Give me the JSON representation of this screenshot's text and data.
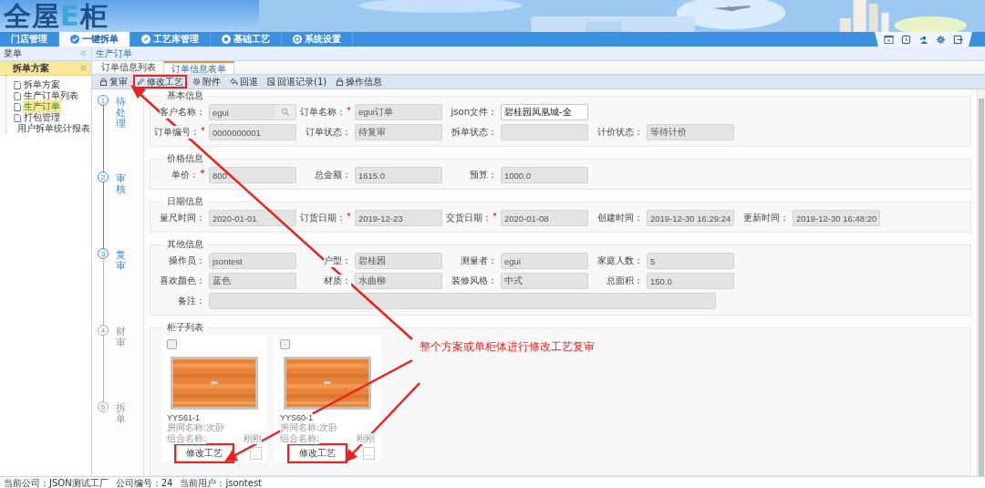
{
  "logo": [
    {
      "text": "全屋",
      "accent": false
    },
    {
      "text": "E",
      "accent": true
    },
    {
      "text": "柜",
      "accent": false
    }
  ],
  "nav_tabs": [
    {
      "label": "门店管理",
      "selected": false
    },
    {
      "label": "一键拆单",
      "selected": true
    },
    {
      "label": "工艺库管理",
      "selected": false
    },
    {
      "label": "基础工艺",
      "selected": false
    },
    {
      "label": "系统设置",
      "selected": false
    }
  ],
  "sidebar": {
    "title": "菜单",
    "group": {
      "label": "拆单方案",
      "expanded": true
    },
    "items": [
      {
        "label": "拆单方案",
        "selected": false
      },
      {
        "label": "生产订单列表",
        "selected": false
      },
      {
        "label": "生产订单",
        "selected": true
      },
      {
        "label": "打包管理",
        "selected": false
      },
      {
        "label": "用户拆单统计报表",
        "selected": false
      }
    ]
  },
  "breadcrumb": "生产订单",
  "page_tabs": [
    {
      "label": "订单信息列表",
      "selected": false
    },
    {
      "label": "订单信息表单",
      "selected": true
    }
  ],
  "toolbar": [
    {
      "label": "复审",
      "highlighted": false
    },
    {
      "label": "修改工艺",
      "highlighted": true
    },
    {
      "label": "附件",
      "highlighted": false
    },
    {
      "label": "回退",
      "highlighted": false
    },
    {
      "label": "回退记录(1)",
      "highlighted": false
    },
    {
      "label": "操作信息",
      "highlighted": false
    }
  ],
  "steps": [
    {
      "number": "1",
      "label": "待处理",
      "active": true
    },
    {
      "number": "2",
      "label": "审核",
      "active": true
    },
    {
      "number": "3",
      "label": "复审",
      "active": true
    },
    {
      "number": "4",
      "label": "财审",
      "active": false
    },
    {
      "number": "5",
      "label": "拆单",
      "active": false
    }
  ],
  "sections": [
    {
      "title": "基本信息",
      "rows": [
        [
          {
            "label": "客户名称：",
            "required": false,
            "kind": "search",
            "value": "egui"
          },
          {
            "label": "订单名称：",
            "required": true,
            "kind": "readonly",
            "value": "egui订单"
          },
          {
            "label": "json文件：",
            "required": false,
            "kind": "input",
            "value": "碧桂园凤凰城-全"
          }
        ],
        [
          {
            "label": "订单编号：",
            "required": true,
            "kind": "readonly",
            "value": "0000000001"
          },
          {
            "label": "订单状态：",
            "required": false,
            "kind": "readonly",
            "value": "待复审"
          },
          {
            "label": "拆单状态：",
            "required": false,
            "kind": "readonly"
          },
          {
            "label": "计价状态：",
            "required": false,
            "kind": "readonly",
            "value": "等待计价"
          }
        ]
      ]
    },
    {
      "title": "价格信息",
      "rows": [
        [
          {
            "label": "单价：",
            "required": true,
            "kind": "readonly",
            "value": "800"
          },
          {
            "label": "总金额：",
            "required": false,
            "kind": "readonly",
            "value": "1615.0"
          },
          {
            "label": "预算：",
            "required": false,
            "kind": "readonly",
            "value": "1000.0"
          }
        ]
      ]
    },
    {
      "title": "日期信息",
      "rows": [
        [
          {
            "label": "量尺时间：",
            "required": false,
            "kind": "readonly",
            "value": "2020-01-01"
          },
          {
            "label": "订货日期：",
            "required": true,
            "kind": "readonly",
            "value": "2019-12-23"
          },
          {
            "label": "交货日期：",
            "required": true,
            "kind": "readonly",
            "value": "2020-01-08"
          },
          {
            "label": "创建时间：",
            "required": false,
            "kind": "readonly",
            "value": "2019-12-30 16:29:24"
          },
          {
            "label": "更新时间：",
            "required": false,
            "kind": "readonly",
            "value": "2019-12-30 16:48:20"
          }
        ]
      ]
    },
    {
      "title": "其他信息",
      "rows": [
        [
          {
            "label": "操作员：",
            "required": false,
            "kind": "readonly",
            "value": "jsontest"
          },
          {
            "label": "户型：",
            "required": false,
            "kind": "readonly",
            "value": "碧桂园"
          },
          {
            "label": "测量者：",
            "required": false,
            "kind": "readonly",
            "value": "egui"
          },
          {
            "label": "家庭人数：",
            "required": false,
            "kind": "readonly",
            "value": "5"
          }
        ],
        [
          {
            "label": "喜欢颜色：",
            "required": false,
            "kind": "readonly",
            "value": "蓝色"
          },
          {
            "label": "材质：",
            "required": false,
            "kind": "readonly",
            "value": "水曲柳"
          },
          {
            "label": "装修风格：",
            "required": false,
            "kind": "readonly",
            "value": "中式"
          },
          {
            "label": "总面积：",
            "required": false,
            "kind": "readonly",
            "value": "150.0"
          }
        ],
        [
          {
            "label": "备注：",
            "required": false,
            "kind": "textarea"
          }
        ]
      ]
    }
  ],
  "cabinet_list": {
    "title": "柜子列表",
    "cards": [
      {
        "name": "YYS61-1",
        "room": "房间名称:次卧",
        "group": "组合名称:",
        "time": "刚刚",
        "checked": false,
        "button": "修改工艺",
        "button_highlighted": true,
        "more": "..."
      },
      {
        "name": "YYS60-1",
        "room": "房间名称:次卧",
        "group": "组合名称:",
        "time": "刚刚",
        "checked": false,
        "button": "修改工艺",
        "button_highlighted": true,
        "more": "..."
      }
    ]
  },
  "annotation": "整个方案或单柜体进行修改工艺复审",
  "status_bar": [
    "当前公司：JSON测试工厂",
    "公司编号：24",
    "当前用户：jsontest"
  ]
}
